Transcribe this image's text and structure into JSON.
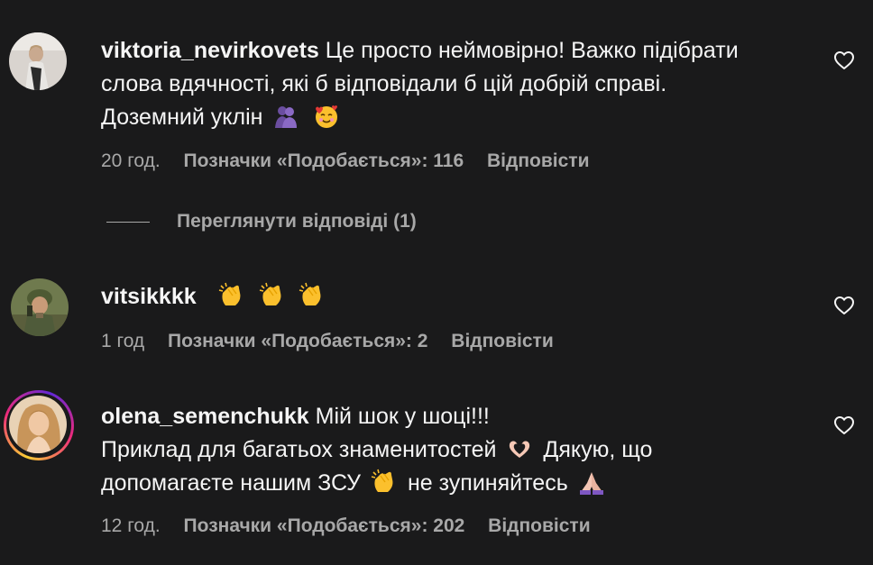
{
  "comments": [
    {
      "username": "viktoria_nevirkovets",
      "text_line1": "Це просто неймовірно! Важко підібрати",
      "text_line2": "слова вдячності, які б відповідали б цій добрій справі.",
      "text_line3": "Доземний уклін",
      "emojis": [
        "hugging-people-emoji",
        "smiling-face-with-hearts-emoji"
      ],
      "time": "20 год.",
      "likes": "Позначки «Подобається»: 116",
      "reply_label": "Відповісти",
      "view_replies": "Переглянути відповіді (1)"
    },
    {
      "username": "vitsikkkk",
      "emojis": [
        "clapping-hands-emoji",
        "clapping-hands-emoji",
        "clapping-hands-emoji"
      ],
      "time": "1 год",
      "likes": "Позначки «Подобається»: 2",
      "reply_label": "Відповісти"
    },
    {
      "username": "olena_semenchukk",
      "text_line1": "Мій шок у шоці!!!",
      "text_line2a": "Приклад для багатьох знаменитостей",
      "text_line2b": "Дякую, що",
      "text_line3a": "допомагаєте нашим ЗСУ",
      "text_line3b": "не зупиняйтесь",
      "emojis": [
        "heart-hands-emoji",
        "clapping-hands-emoji",
        "folded-hands-emoji"
      ],
      "time": "12 год.",
      "likes": "Позначки «Подобається»: 202",
      "reply_label": "Відповісти"
    }
  ],
  "icons": {
    "like": "heart-outline-icon"
  },
  "colors": {
    "background": "#1a1a1b",
    "text": "#f5f5f5",
    "muted": "#a8a8a8"
  }
}
